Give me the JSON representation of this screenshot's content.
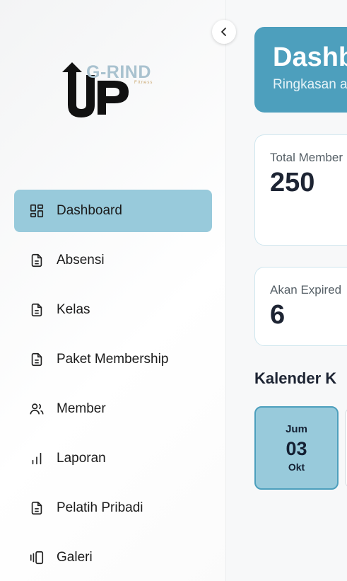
{
  "sidebar": {
    "logo_top": "G-RIND",
    "logo_sub": "Fitness",
    "logo_main": "UP",
    "items": [
      {
        "label": "Dashboard",
        "icon": "dashboard-icon",
        "active": true
      },
      {
        "label": "Absensi",
        "icon": "document-icon"
      },
      {
        "label": "Kelas",
        "icon": "document-icon"
      },
      {
        "label": "Paket Membership",
        "icon": "document-icon"
      },
      {
        "label": "Member",
        "icon": "users-icon"
      },
      {
        "label": "Laporan",
        "icon": "bar-chart-icon"
      },
      {
        "label": "Pelatih Pribadi",
        "icon": "document-icon"
      },
      {
        "label": "Galeri",
        "icon": "gallery-icon"
      }
    ]
  },
  "header": {
    "title": "Dashb",
    "subtitle": "Ringkasan a"
  },
  "stats": [
    {
      "label": "Total Member",
      "value": "250"
    },
    {
      "label": "Akan Expired",
      "value": "6"
    }
  ],
  "calendar": {
    "title": "Kalender K",
    "days": [
      {
        "day": "Jum",
        "date": "03",
        "month": "Okt",
        "selected": true
      }
    ]
  },
  "colors": {
    "accent": "#4d9fbd",
    "active_bg": "#98cadb",
    "text_dark": "#1d2433"
  }
}
